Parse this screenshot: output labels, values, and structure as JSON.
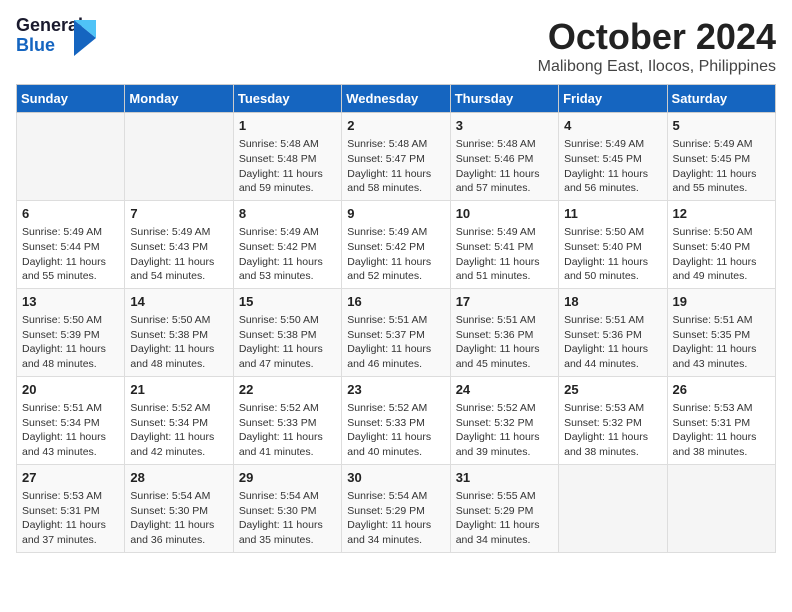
{
  "logo": {
    "line1": "General",
    "line2": "Blue"
  },
  "header": {
    "month": "October 2024",
    "location": "Malibong East, Ilocos, Philippines"
  },
  "weekdays": [
    "Sunday",
    "Monday",
    "Tuesday",
    "Wednesday",
    "Thursday",
    "Friday",
    "Saturday"
  ],
  "weeks": [
    [
      {
        "day": "",
        "content": ""
      },
      {
        "day": "",
        "content": ""
      },
      {
        "day": "1",
        "content": "Sunrise: 5:48 AM\nSunset: 5:48 PM\nDaylight: 11 hours\nand 59 minutes."
      },
      {
        "day": "2",
        "content": "Sunrise: 5:48 AM\nSunset: 5:47 PM\nDaylight: 11 hours\nand 58 minutes."
      },
      {
        "day": "3",
        "content": "Sunrise: 5:48 AM\nSunset: 5:46 PM\nDaylight: 11 hours\nand 57 minutes."
      },
      {
        "day": "4",
        "content": "Sunrise: 5:49 AM\nSunset: 5:45 PM\nDaylight: 11 hours\nand 56 minutes."
      },
      {
        "day": "5",
        "content": "Sunrise: 5:49 AM\nSunset: 5:45 PM\nDaylight: 11 hours\nand 55 minutes."
      }
    ],
    [
      {
        "day": "6",
        "content": "Sunrise: 5:49 AM\nSunset: 5:44 PM\nDaylight: 11 hours\nand 55 minutes."
      },
      {
        "day": "7",
        "content": "Sunrise: 5:49 AM\nSunset: 5:43 PM\nDaylight: 11 hours\nand 54 minutes."
      },
      {
        "day": "8",
        "content": "Sunrise: 5:49 AM\nSunset: 5:42 PM\nDaylight: 11 hours\nand 53 minutes."
      },
      {
        "day": "9",
        "content": "Sunrise: 5:49 AM\nSunset: 5:42 PM\nDaylight: 11 hours\nand 52 minutes."
      },
      {
        "day": "10",
        "content": "Sunrise: 5:49 AM\nSunset: 5:41 PM\nDaylight: 11 hours\nand 51 minutes."
      },
      {
        "day": "11",
        "content": "Sunrise: 5:50 AM\nSunset: 5:40 PM\nDaylight: 11 hours\nand 50 minutes."
      },
      {
        "day": "12",
        "content": "Sunrise: 5:50 AM\nSunset: 5:40 PM\nDaylight: 11 hours\nand 49 minutes."
      }
    ],
    [
      {
        "day": "13",
        "content": "Sunrise: 5:50 AM\nSunset: 5:39 PM\nDaylight: 11 hours\nand 48 minutes."
      },
      {
        "day": "14",
        "content": "Sunrise: 5:50 AM\nSunset: 5:38 PM\nDaylight: 11 hours\nand 48 minutes."
      },
      {
        "day": "15",
        "content": "Sunrise: 5:50 AM\nSunset: 5:38 PM\nDaylight: 11 hours\nand 47 minutes."
      },
      {
        "day": "16",
        "content": "Sunrise: 5:51 AM\nSunset: 5:37 PM\nDaylight: 11 hours\nand 46 minutes."
      },
      {
        "day": "17",
        "content": "Sunrise: 5:51 AM\nSunset: 5:36 PM\nDaylight: 11 hours\nand 45 minutes."
      },
      {
        "day": "18",
        "content": "Sunrise: 5:51 AM\nSunset: 5:36 PM\nDaylight: 11 hours\nand 44 minutes."
      },
      {
        "day": "19",
        "content": "Sunrise: 5:51 AM\nSunset: 5:35 PM\nDaylight: 11 hours\nand 43 minutes."
      }
    ],
    [
      {
        "day": "20",
        "content": "Sunrise: 5:51 AM\nSunset: 5:34 PM\nDaylight: 11 hours\nand 43 minutes."
      },
      {
        "day": "21",
        "content": "Sunrise: 5:52 AM\nSunset: 5:34 PM\nDaylight: 11 hours\nand 42 minutes."
      },
      {
        "day": "22",
        "content": "Sunrise: 5:52 AM\nSunset: 5:33 PM\nDaylight: 11 hours\nand 41 minutes."
      },
      {
        "day": "23",
        "content": "Sunrise: 5:52 AM\nSunset: 5:33 PM\nDaylight: 11 hours\nand 40 minutes."
      },
      {
        "day": "24",
        "content": "Sunrise: 5:52 AM\nSunset: 5:32 PM\nDaylight: 11 hours\nand 39 minutes."
      },
      {
        "day": "25",
        "content": "Sunrise: 5:53 AM\nSunset: 5:32 PM\nDaylight: 11 hours\nand 38 minutes."
      },
      {
        "day": "26",
        "content": "Sunrise: 5:53 AM\nSunset: 5:31 PM\nDaylight: 11 hours\nand 38 minutes."
      }
    ],
    [
      {
        "day": "27",
        "content": "Sunrise: 5:53 AM\nSunset: 5:31 PM\nDaylight: 11 hours\nand 37 minutes."
      },
      {
        "day": "28",
        "content": "Sunrise: 5:54 AM\nSunset: 5:30 PM\nDaylight: 11 hours\nand 36 minutes."
      },
      {
        "day": "29",
        "content": "Sunrise: 5:54 AM\nSunset: 5:30 PM\nDaylight: 11 hours\nand 35 minutes."
      },
      {
        "day": "30",
        "content": "Sunrise: 5:54 AM\nSunset: 5:29 PM\nDaylight: 11 hours\nand 34 minutes."
      },
      {
        "day": "31",
        "content": "Sunrise: 5:55 AM\nSunset: 5:29 PM\nDaylight: 11 hours\nand 34 minutes."
      },
      {
        "day": "",
        "content": ""
      },
      {
        "day": "",
        "content": ""
      }
    ]
  ]
}
